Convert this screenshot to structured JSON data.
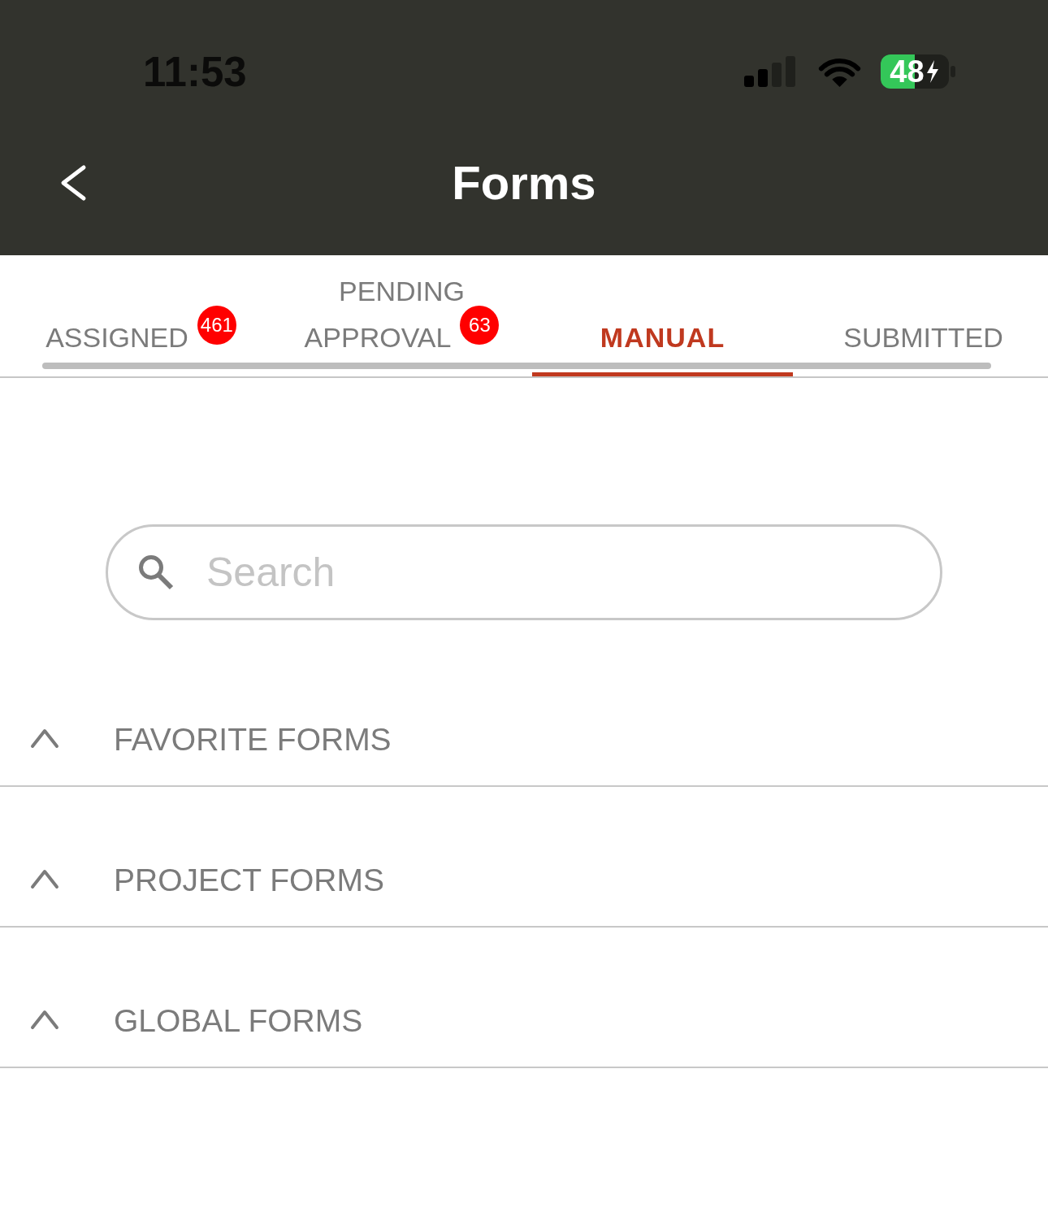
{
  "status_bar": {
    "time": "11:53",
    "battery": "48"
  },
  "header": {
    "title": "Forms"
  },
  "tabs": [
    {
      "label": "ASSIGNED",
      "badge": "461",
      "selected": false
    },
    {
      "label": "PENDING APPROVAL",
      "badge": "63",
      "selected": false
    },
    {
      "label": "MANUAL",
      "selected": true
    },
    {
      "label": "SUBMITTED",
      "selected": false
    }
  ],
  "search": {
    "placeholder": "Search"
  },
  "sections": [
    {
      "title": "FAVORITE FORMS"
    },
    {
      "title": "PROJECT FORMS"
    },
    {
      "title": "GLOBAL FORMS"
    }
  ]
}
